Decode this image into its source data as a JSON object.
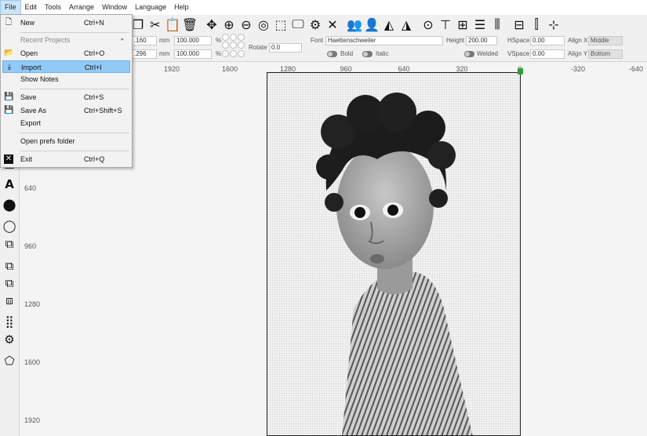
{
  "menubar": {
    "items": [
      "File",
      "Edit",
      "Tools",
      "Arrange",
      "Window",
      "Language",
      "Help"
    ]
  },
  "file_menu": {
    "new": {
      "label": "New",
      "shortcut": "Ctrl+N"
    },
    "recent": {
      "label": "Recent Projects"
    },
    "open": {
      "label": "Open",
      "shortcut": "Ctrl+O"
    },
    "import": {
      "label": "Import",
      "shortcut": "Ctrl+I"
    },
    "show_notes": {
      "label": "Show Notes"
    },
    "save": {
      "label": "Save",
      "shortcut": "Ctrl+S"
    },
    "save_as": {
      "label": "Save As",
      "shortcut": "Ctrl+Shift+S"
    },
    "export": {
      "label": "Export"
    },
    "open_prefs": {
      "label": "Open prefs folder"
    },
    "exit": {
      "label": "Exit",
      "shortcut": "Ctrl+Q"
    }
  },
  "transform": {
    "x_value": ".160",
    "y_value": ".296",
    "unit": "mm",
    "width_pct": "100.000",
    "height_pct": "100.000",
    "pct": "%",
    "rotate_label": "Rotate",
    "rotate_value": "0.0"
  },
  "text_props": {
    "font_label": "Font",
    "font_value": "Haettenschweiler",
    "height_label": "Height",
    "height_value": "200.00",
    "bold_label": "Bold",
    "italic_label": "Italic",
    "welded_label": "Welded",
    "hspace_label": "HSpace",
    "hspace_value": "0.00",
    "vspace_label": "VSpace",
    "vspace_value": "0.00",
    "align_x_label": "Align X",
    "align_x_value": "Middle",
    "align_y_label": "Align Y",
    "align_y_value": "Bottom"
  },
  "ruler_top": [
    "1920",
    "1600",
    "1280",
    "960",
    "640",
    "320",
    "0",
    "-320",
    "-640"
  ],
  "ruler_left": [
    "640",
    "960",
    "1280",
    "1600",
    "1920"
  ]
}
